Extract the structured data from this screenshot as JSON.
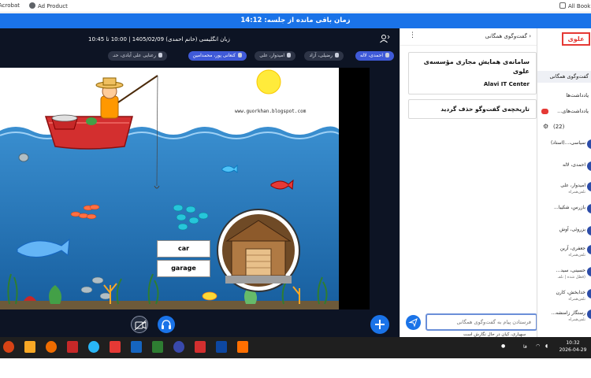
{
  "browser": {
    "bookmarks": [
      "Acrobat",
      "Ad Product",
      "All Book"
    ]
  },
  "session": {
    "timer_text": "زمان باقی مانده از جلسه: 14:12"
  },
  "stage": {
    "header_text": "زبان انگلیسی (خانم احمدی) 1405/02/09 | 10:00 تا 10:45",
    "participants": [
      {
        "label": "احمدی، لاله",
        "active": true
      },
      {
        "label": "رضیلی، آزاد",
        "active": false
      },
      {
        "label": "امیدوار، علی",
        "active": false
      },
      {
        "label": "کنعانی پور، محمدامین",
        "active": true
      },
      {
        "label": "رعنایی علی آبادی، حنـ",
        "active": false
      }
    ],
    "slide": {
      "website": "www.guorkhan.blogspot.com",
      "word1": "car",
      "word2": "garage"
    },
    "controls": {
      "video_icon": "video-off-icon",
      "audio_icon": "headset-icon",
      "add_icon": "plus-icon"
    }
  },
  "chat": {
    "header_title": "گفت‌وگوی همگانی",
    "welcome_title": "سامانه‌ی همایش مجازی مؤسسه‌ی علوی",
    "welcome_subtitle": "Alavi IT Center",
    "cleared_message": "تاریخچه‌ی گفت‌وگو حذف گردید",
    "input_placeholder": "فرستادن پیام به گفت‌وگوی همگانی",
    "typing_text": "سهیاری، کیان در حال نگارش است"
  },
  "sidebar": {
    "logo": "علوی",
    "items": [
      {
        "label": "گفت‌وگوی همگانی",
        "selected": true
      },
      {
        "label": "یادداشت‌ها",
        "selected": false
      },
      {
        "label": "یادداشت‌های...",
        "selected": false
      }
    ],
    "users_label": "(22)",
    "users": [
      {
        "name": "سیاسی،...(استاد)",
        "sub": ""
      },
      {
        "name": "احمدی، لاله",
        "sub": ""
      },
      {
        "name": "امیدوار، علی",
        "sub": "تلفن‌همراه"
      },
      {
        "name": "بازرس، شکیبا...",
        "sub": ""
      },
      {
        "name": "بزروئی، آوش",
        "sub": ""
      },
      {
        "name": "جعفری، آرین",
        "sub": "تلفن‌همراه"
      },
      {
        "name": "حسینی، سید...",
        "sub": "(قطل شده | تلفـ"
      },
      {
        "name": "خدابخش، کارن",
        "sub": "تلفن‌همراه"
      },
      {
        "name": "رستگار زامنشه...",
        "sub": "تلفن‌همراه"
      }
    ]
  },
  "taskbar": {
    "lang": "فا",
    "time": "10:32",
    "date": "2026-04-29"
  },
  "colors": {
    "accent": "#1a73e8",
    "stage_bg": "#0d1424",
    "water": "#1b73b8",
    "boat": "#d32f2f",
    "sun": "#ffeb3b",
    "logo_red": "#e53935"
  }
}
